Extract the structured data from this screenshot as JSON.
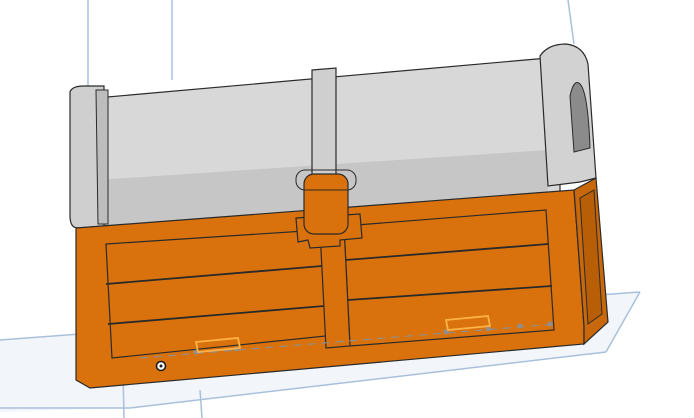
{
  "viewport": {
    "background": "#ffffff",
    "grid_color": "#a9c0dc",
    "grid_fill": "#f2f6fb"
  },
  "model": {
    "lid_color": "#d8d8d8",
    "lid_shade": "#b9b9b9",
    "band_color": "#cfcfcf",
    "base_color": "#d9720c",
    "base_dark": "#b85e06",
    "outline_color": "#2a2a2a",
    "selection_color": "#ffb347",
    "axis_color": "#8f8f8f"
  },
  "icons": {
    "workplane_origin": "origin-marker-icon"
  }
}
